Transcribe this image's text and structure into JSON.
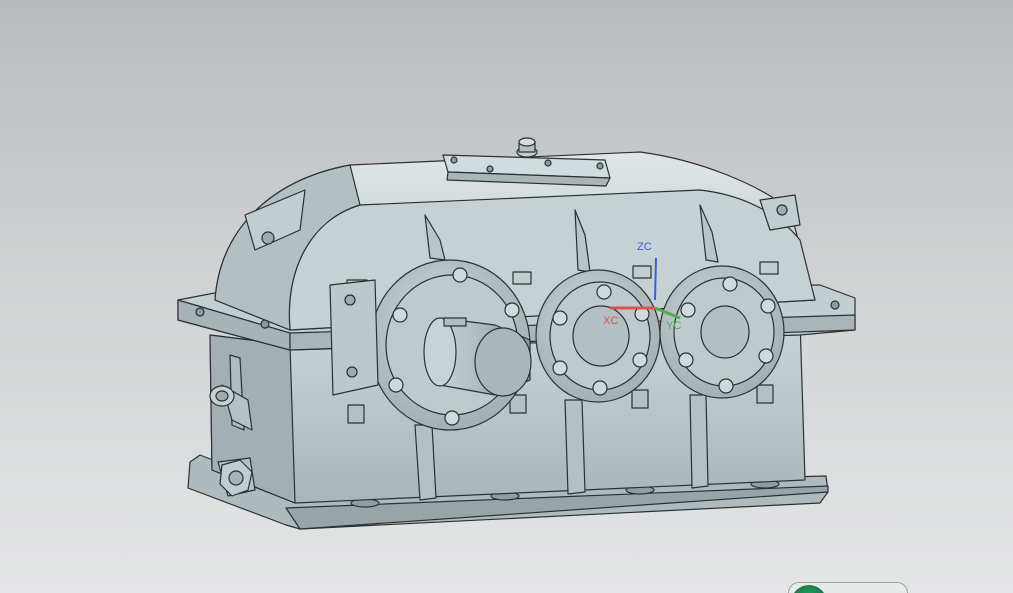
{
  "viewport": {
    "background_top": "#b8bbbd",
    "background_bottom": "#e4e5e6"
  },
  "model": {
    "body_color": "#b9c6c9",
    "edge_color": "#2b3133"
  },
  "triad": {
    "z_label": "ZC",
    "x_label": "XC",
    "y_label": "YC",
    "z_color": "#3a5fe0",
    "x_color": "#e05050",
    "y_color": "#4caf50"
  },
  "status_badge": {
    "icon": "logo-icon",
    "color": "#137a46"
  }
}
